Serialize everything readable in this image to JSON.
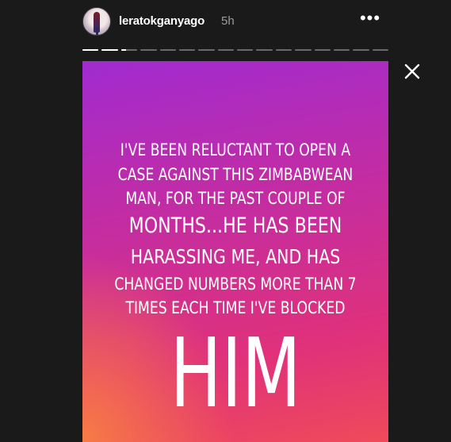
{
  "header": {
    "username": "leratokganyago",
    "timestamp": "5h",
    "more_icon": "more-horizontal-icon",
    "more_label": "•••"
  },
  "progress": {
    "segment_count": 16,
    "completed_segments": 2,
    "current_segment_progress": 0.3
  },
  "close_icon": "close-icon",
  "story": {
    "lines": [
      "I'VE BEEN RELUCTANT TO OPEN A",
      "CASE AGAINST THIS ZIMBABWEAN",
      "MAN, FOR THE PAST COUPLE OF",
      "MONTHS...HE HAS BEEN",
      "HARASSING ME, AND HAS",
      "CHANGED NUMBERS MORE THAN 7",
      "TIMES EACH TIME I'VE BLOCKED"
    ],
    "big_word": "HIM",
    "gradient_colors": [
      "#a12bd0",
      "#c02ca6",
      "#e0317a",
      "#f77b45"
    ]
  },
  "colors": {
    "background": "#1a1a1a",
    "username": "#ffffff",
    "timestamp": "#9c9c9c"
  }
}
